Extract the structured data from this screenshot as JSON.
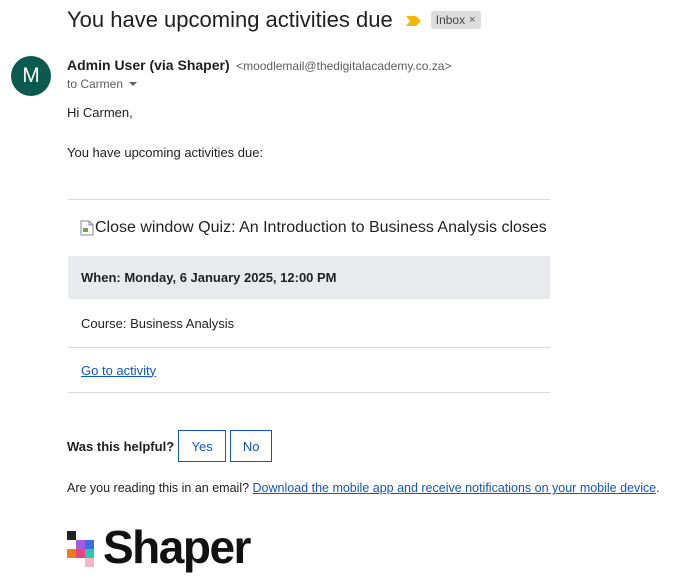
{
  "email": {
    "subject": "You have upcoming activities due",
    "label": "Inbox",
    "label_close": "×",
    "avatar_letter": "M",
    "sender_name": "Admin User (via Shaper)",
    "sender_email": "<moodlemail@thedigitalacademy.co.za>",
    "to_line": "to Carmen"
  },
  "body": {
    "greeting": "Hi Carmen,",
    "intro": "You have upcoming activities due:",
    "activity": {
      "image_alt": "Close window",
      "title": "Quiz: An Introduction to Business Analysis closes",
      "when": "When: Monday, 6 January 2025, 12:00 PM",
      "course": "Course: Business Analysis",
      "link": "Go to activity"
    },
    "feedback": {
      "question": "Was this helpful?",
      "yes": "Yes",
      "no": "No"
    },
    "mobile": {
      "prefix": "Are you reading this in an email? ",
      "link": "Download the mobile app and receive notifications on your mobile device",
      "suffix": "."
    },
    "brand": "Shaper"
  },
  "colors": {
    "avatar": "#0b5a4d",
    "link": "#1155cc",
    "importance": "#f2b705",
    "logo_squares": [
      "#222222",
      "#3b6fe0",
      "#a65ce0",
      "#f27a1a",
      "#e8467c",
      "#2ec4b6",
      "#f5b7c6"
    ]
  }
}
